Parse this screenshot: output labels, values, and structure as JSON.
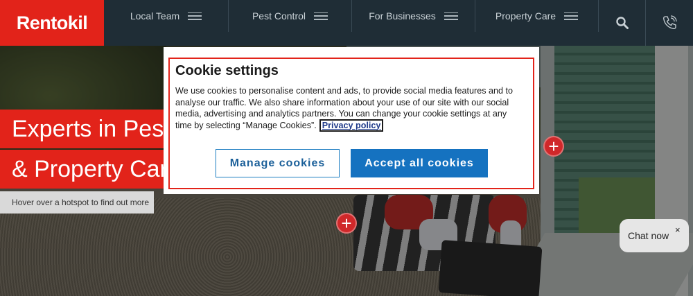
{
  "header": {
    "logo_text": "Rentokil",
    "nav": [
      {
        "label": "Local Team"
      },
      {
        "label": "Pest Control"
      },
      {
        "label": "For Businesses"
      },
      {
        "label": "Property Care"
      }
    ],
    "icons": [
      "search-icon",
      "phone-icon"
    ]
  },
  "hero": {
    "headline_line1": "Experts in Pest",
    "headline_line2": "& Property Care",
    "hotspot_hint": "Hover over a hotspot to find out more",
    "hotspot_symbol": "+"
  },
  "chat": {
    "label": "Chat now",
    "close": "×"
  },
  "cookie_modal": {
    "title": "Cookie settings",
    "body": "We use cookies to personalise content and ads, to provide social media features and to analyse our traffic. We also share information about your use of our site with our social media, advertising and analytics partners. You can change your cookie settings at any time by selecting “Manage Cookies”.",
    "privacy_link": "Privacy policy",
    "manage_button": "Manage cookies",
    "accept_button": "Accept all cookies"
  },
  "colors": {
    "brand_red": "#e2231a",
    "header_bg": "#1f2d36",
    "accept_blue": "#1572c0",
    "link_blue": "#1f3a8a"
  }
}
